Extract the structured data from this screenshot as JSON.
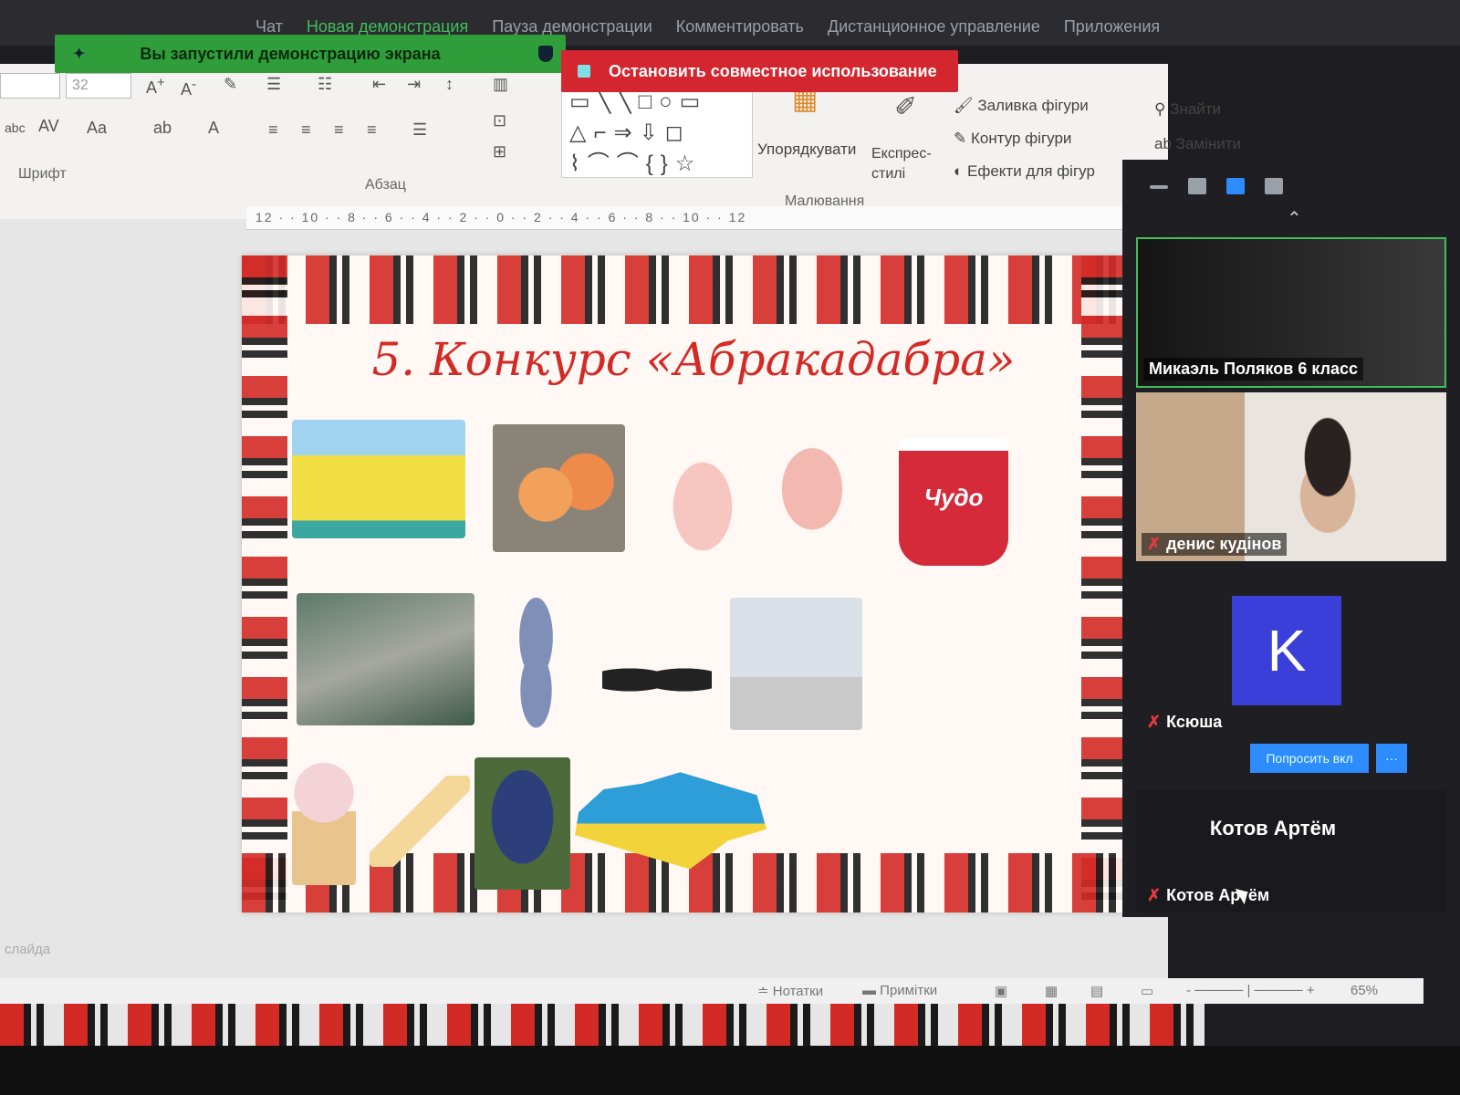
{
  "zoom_toolbar": {
    "items": [
      "Чат",
      "Новая демонстрация",
      "Пауза демонстрации",
      "Комментировать",
      "Дистанционное управление",
      "Приложения"
    ]
  },
  "sharing": {
    "banner": "Вы запустили демонстрацию экрана",
    "stop_button": "Остановить совместное использование"
  },
  "ribbon": {
    "font_size": "32",
    "font_group": "Шрифт",
    "paragraph_group": "Абзац",
    "drawing_group": "Малювання",
    "arrange": "Упорядкувати",
    "quick_styles": "Експрес-стилі",
    "shape_fill": "Заливка фігури",
    "shape_outline": "Контур фігури",
    "shape_effects": "Ефекти для фігур",
    "find": "Знайти",
    "replace": "Замінити"
  },
  "ruler": "12 · · 10 · · 8 · · 6 · · 4 · · 2 · · 0 · · 2 · · 4 · · 6 · · 8 · · 10 · · 12",
  "slide": {
    "title": "5. Конкурс «Абракадабра»",
    "yogurt_label": "Чудо"
  },
  "status_bar": {
    "slide_label": "слайда",
    "notes": "Нотатки",
    "comments": "Примітки",
    "zoom": "65%"
  },
  "participants": {
    "tiles": [
      {
        "name": "Микаэль Поляков 6 класс",
        "muted": false
      },
      {
        "name": "денис кудінов",
        "muted": true
      },
      {
        "name": "Ксюша",
        "muted": true,
        "avatar": "K"
      },
      {
        "name": "Котов Артём",
        "muted": true
      }
    ],
    "ask_unmute": "Попросить вкл",
    "more": "···",
    "center_name": "Котов Артём"
  },
  "colors": {
    "ornament_red": "#d42a26",
    "ornament_black": "#1a1a1a",
    "zoom_green": "#2f9e3a",
    "zoom_red": "#d3262f",
    "zoom_blue": "#2d8cff"
  }
}
